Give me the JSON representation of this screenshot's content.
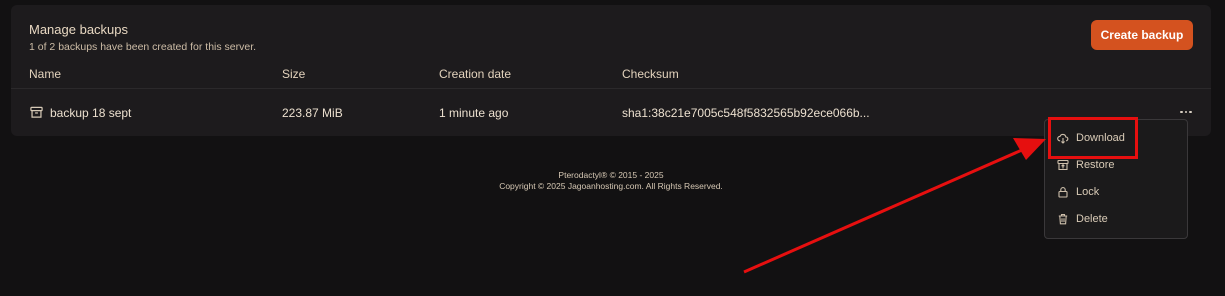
{
  "panel": {
    "title": "Manage backups",
    "subtitle": "1 of 2 backups have been created for this server.",
    "create_button_label": "Create backup"
  },
  "table": {
    "headers": {
      "name": "Name",
      "size": "Size",
      "created": "Creation date",
      "checksum": "Checksum"
    },
    "rows": [
      {
        "icon": "archive-icon",
        "name": "backup 18 sept",
        "size": "223.87 MiB",
        "created": "1 minute ago",
        "checksum": "sha1:38c21e7005c548f5832565b92ece066b..."
      }
    ]
  },
  "menu": {
    "items": [
      {
        "icon": "cloud-download-icon",
        "label": "Download"
      },
      {
        "icon": "restore-icon",
        "label": "Restore"
      },
      {
        "icon": "lock-icon",
        "label": "Lock"
      },
      {
        "icon": "trash-icon",
        "label": "Delete"
      }
    ]
  },
  "footer": {
    "line1": "Pterodactyl® © 2015 - 2025",
    "line2": "Copyright © 2025 Jagoanhosting.com. All Rights Reserved."
  },
  "colors": {
    "background": "#121112",
    "panel": "#1d1b1d",
    "accent_button": "#d4521f",
    "annotation_red": "#e60f0f",
    "text": "#d8c9b6"
  }
}
